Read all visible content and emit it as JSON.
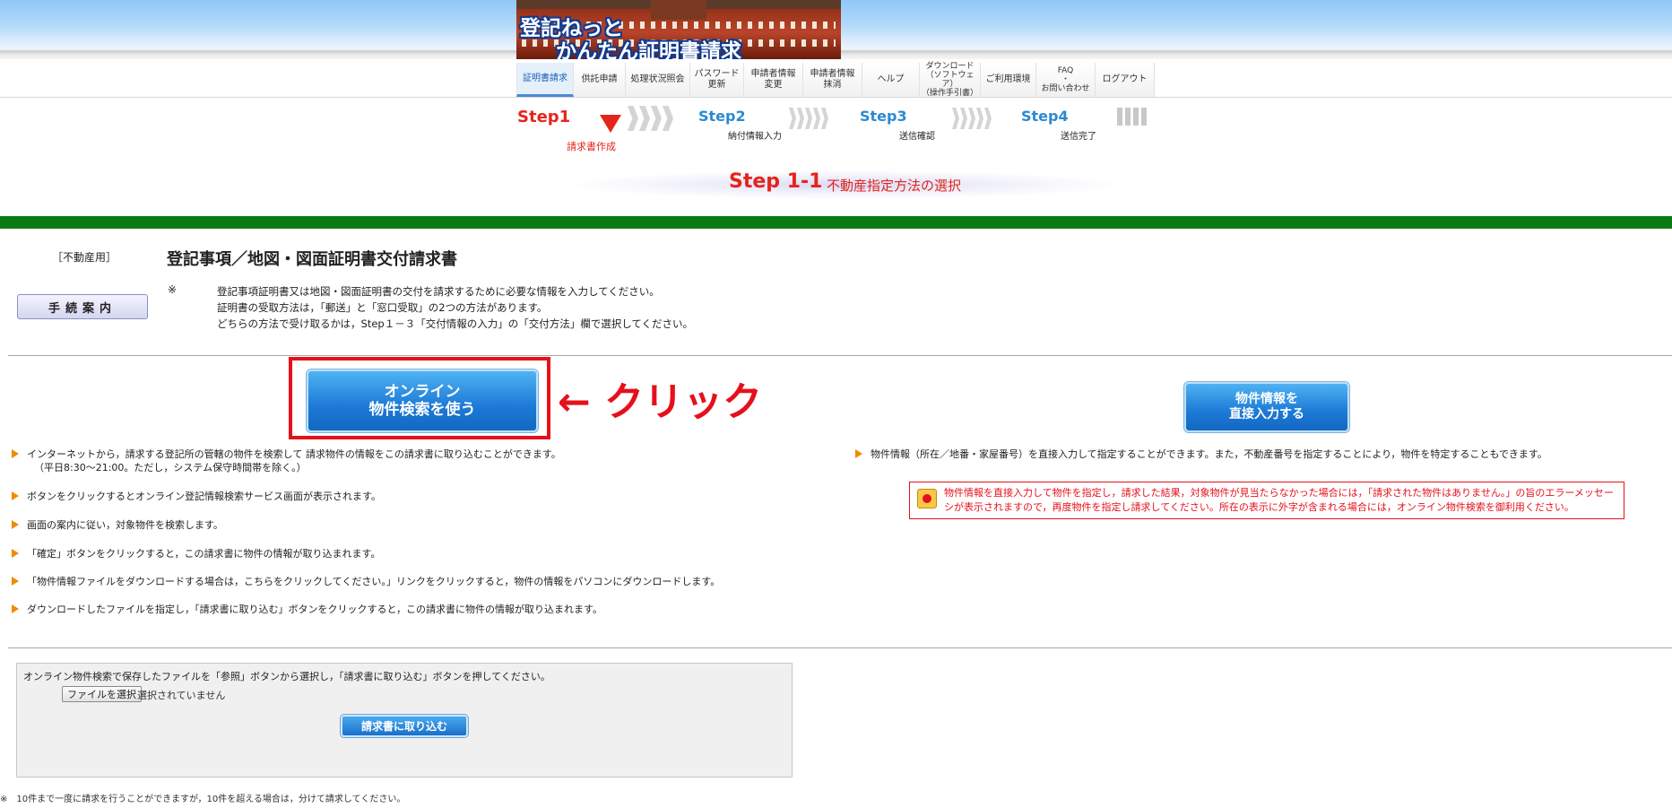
{
  "header": {
    "logo_line1": "登記ねっと",
    "logo_line2": "かんたん証明書請求"
  },
  "nav": [
    "証明書請求",
    "供託申請",
    "処理状況照会",
    "パスワード\n更新",
    "申請者情報\n変更",
    "申請者情報\n抹消",
    "ヘルプ",
    "ダウンロード\n（ソフトウェア）\n（操作手引書）",
    "ご利用環境",
    "FAQ\n・\nお問い合わせ",
    "ログアウト"
  ],
  "steps": {
    "step1": "Step1",
    "step1_sub": "請求書作成",
    "step2": "Step2",
    "step2_sub": "納付情報入力",
    "step3": "Step3",
    "step3_sub": "送信確認",
    "step4": "Step4",
    "step4_sub": "送信完了"
  },
  "substep": {
    "label": "Step 1-1",
    "title": "不動産指定方法の選択"
  },
  "form": {
    "category": "［不動産用］",
    "title": "登記事項／地図・図面証明書交付請求書",
    "guide_button": "手続案内",
    "note_mark": "※",
    "notes": [
      "登記事項証明書又は地図・図面証明書の交付を請求するために必要な情報を入力してください。",
      "証明書の受取方法は，「郵送」と「窓口受取」の2つの方法があります。",
      "どちらの方法で受け取るかは，Step１－３「交付情報の入力」の「交付方法」欄で選択してください。"
    ]
  },
  "actions": {
    "online_button_l1": "オンライン",
    "online_button_l2": "物件検索を使う",
    "click_annotation": "← クリック",
    "direct_button_l1": "物件情報を",
    "direct_button_l2": "直接入力する"
  },
  "left_bullets": [
    "インターネットから，請求する登記所の管轄の物件を検索して 請求物件の情報をこの請求書に取り込むことができます。",
    "（平日8:30～21:00。ただし，システム保守時間帯を除く。）",
    "ボタンをクリックするとオンライン登記情報検索サービス画面が表示されます。",
    "画面の案内に従い，対象物件を検索します。",
    "「確定」ボタンをクリックすると，この請求書に物件の情報が取り込まれます。",
    "「物件情報ファイルをダウンロードする場合は，こちらをクリックしてください。」リンクをクリックすると，物件の情報をパソコンにダウンロードします。",
    "ダウンロードしたファイルを指定し，「請求書に取り込む」ボタンをクリックすると，この請求書に物件の情報が取り込まれます。"
  ],
  "right_bullet": "物件情報（所在／地番・家屋番号）を直接入力して指定することができます。また，不動産番号を指定することにより，物件を特定することもできます。",
  "warning": {
    "line1": "物件情報を直接入力して物件を指定し，請求した結果，対象物件が見当たらなかった場合には，「請求された物件はありません。」の旨のエラーメッセー",
    "line2": "シが表示されますので，再度物件を指定し請求してください。所在の表示に外字が含まれる場合には，オンライン物件検索を御利用ください。"
  },
  "upload": {
    "note": "オンライン物件検索で保存したファイルを「参照」ボタンから選択し，「請求書に取り込む」ボタンを押してください。",
    "file_button": "ファイルを選択",
    "file_status": "選択されていません",
    "import_button": "請求書に取り込む"
  },
  "footer_note": "※　10件まで一度に請求を行うことができますが，10件を超える場合は，分けて請求してください。"
}
